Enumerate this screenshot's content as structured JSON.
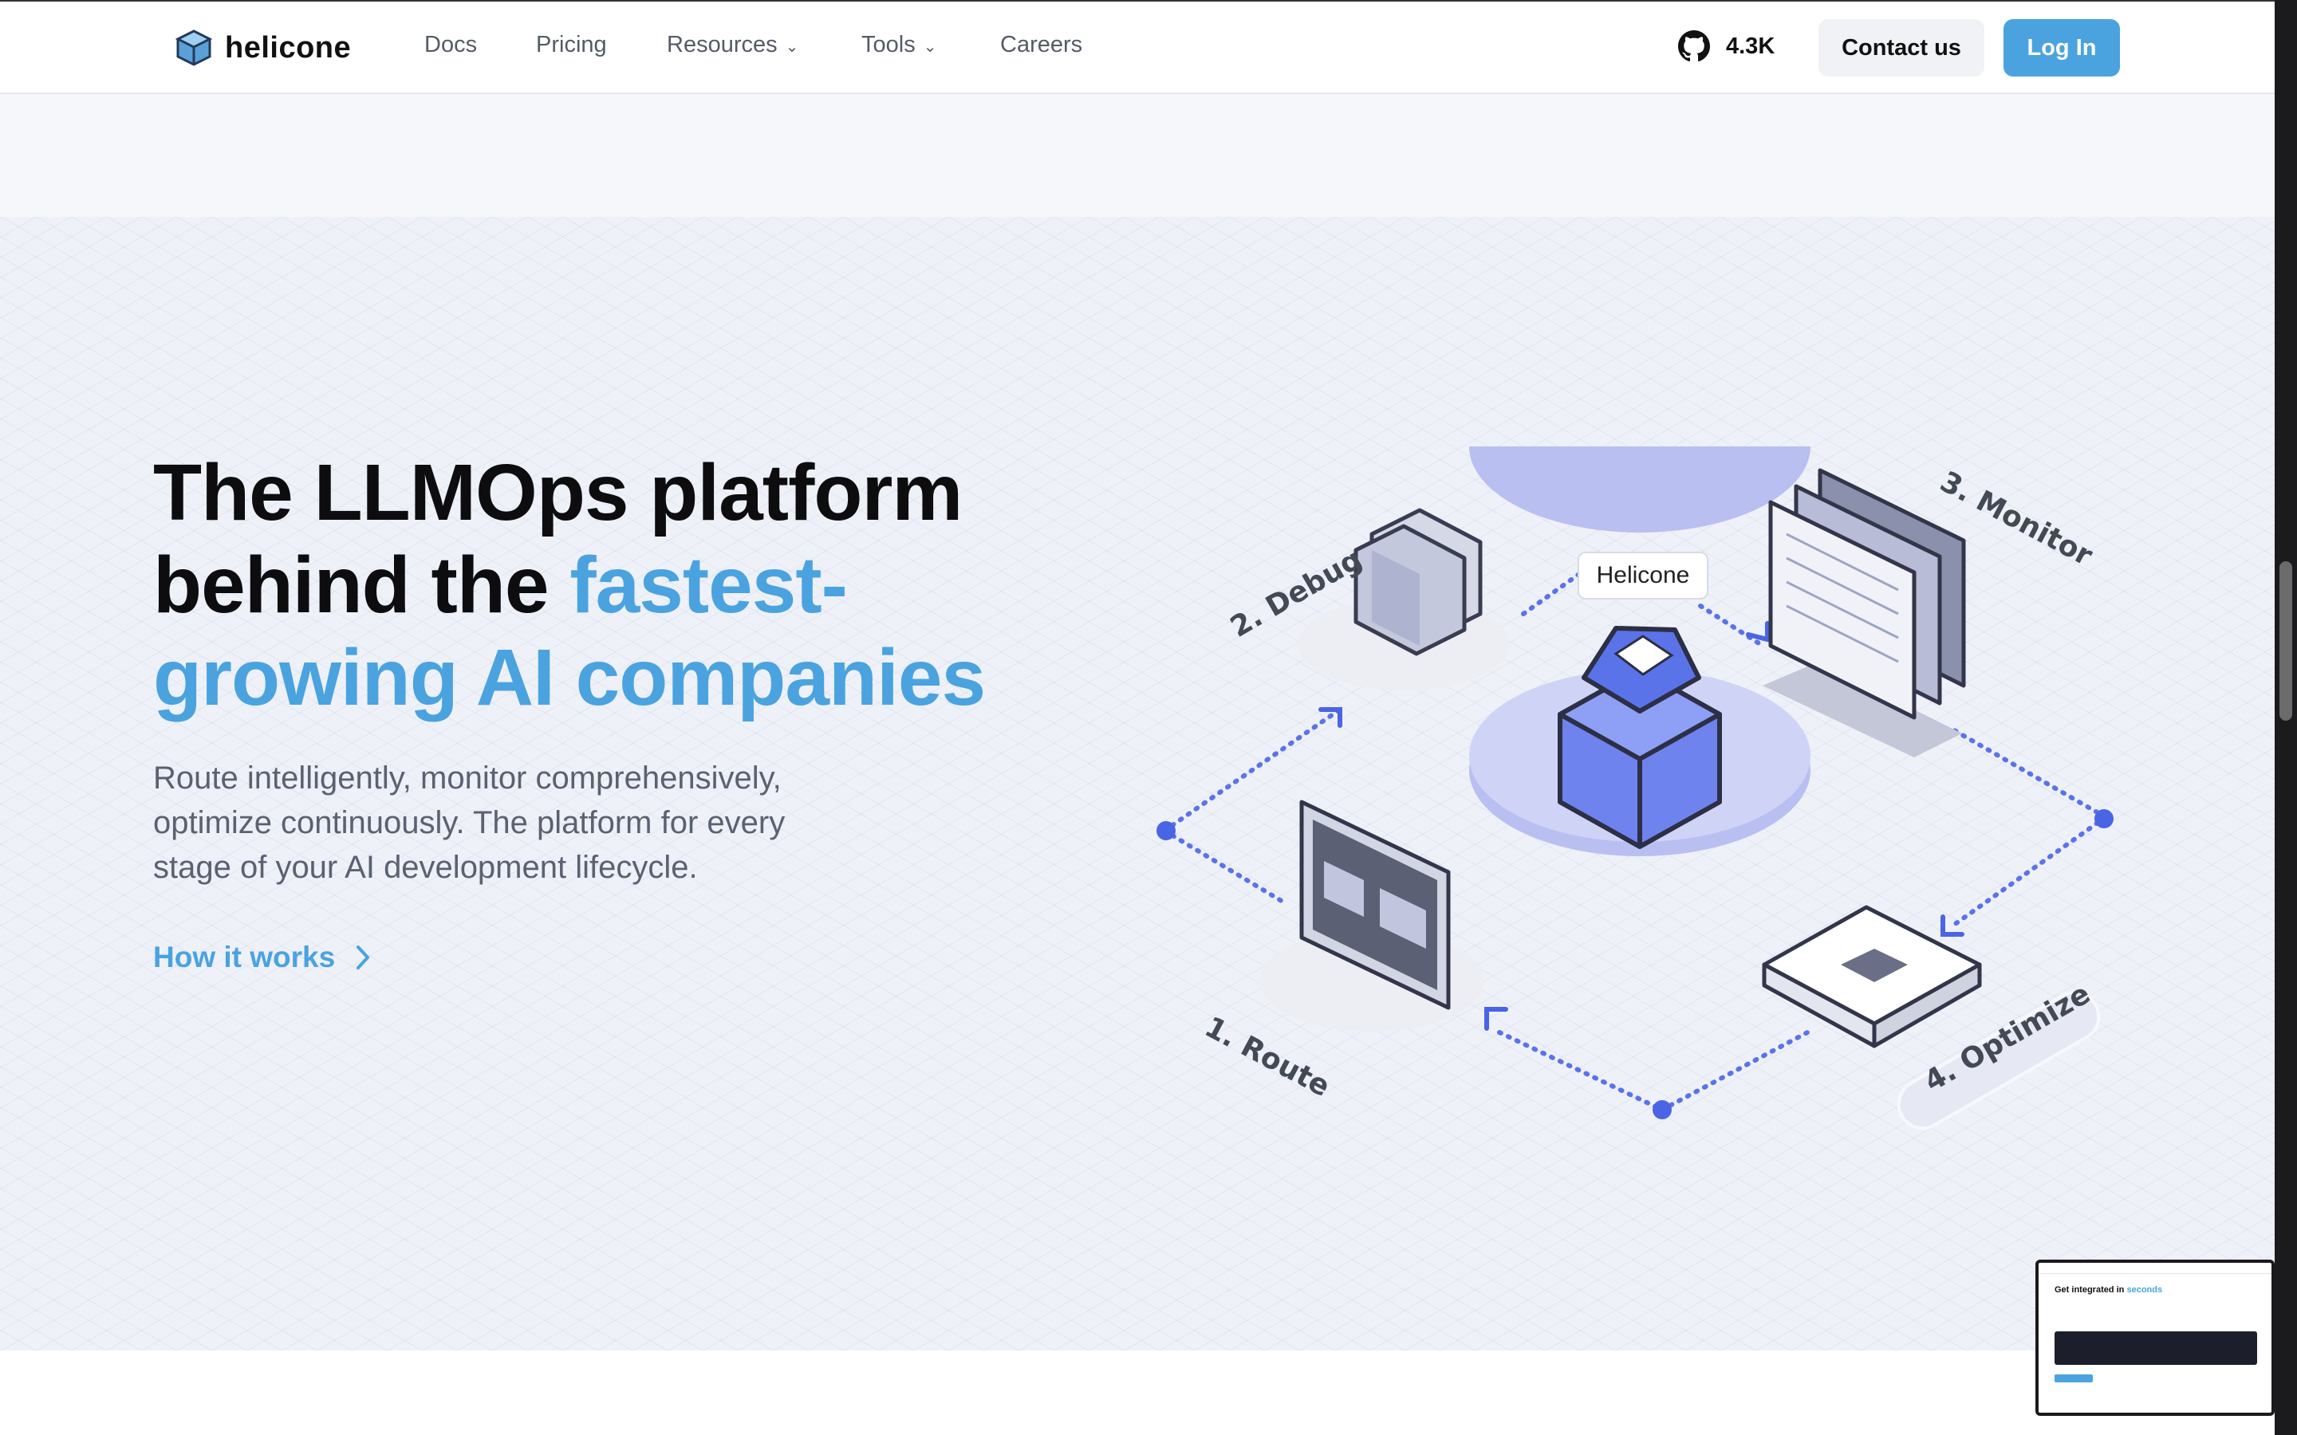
{
  "nav": {
    "brand": "helicone",
    "links": [
      {
        "label": "Docs"
      },
      {
        "label": "Pricing"
      },
      {
        "label": "Resources"
      },
      {
        "label": "Tools"
      },
      {
        "label": "Careers"
      }
    ],
    "github_count": "4.3K",
    "contact_label": "Contact us",
    "login_label": "Log In"
  },
  "hero": {
    "title_part1": "The LLMOps platform behind the ",
    "title_accent": "fastest-growing AI companies",
    "subtitle": "Route intelligently, monitor comprehensively, optimize continuously. The platform for every stage of your AI development lifecycle.",
    "cta_label": "How it works"
  },
  "diagram": {
    "center_label": "Helicone",
    "steps": [
      "1. Route",
      "2. Debug",
      "3. Monitor",
      "4. Optimize"
    ]
  },
  "mini_preview": {
    "title_part1": "Get integrated in ",
    "title_accent": "seconds"
  },
  "colors": {
    "accent": "#4aa3df",
    "diagram_blue": "#5b73e8",
    "platform_lavender": "#c9cdf3"
  }
}
